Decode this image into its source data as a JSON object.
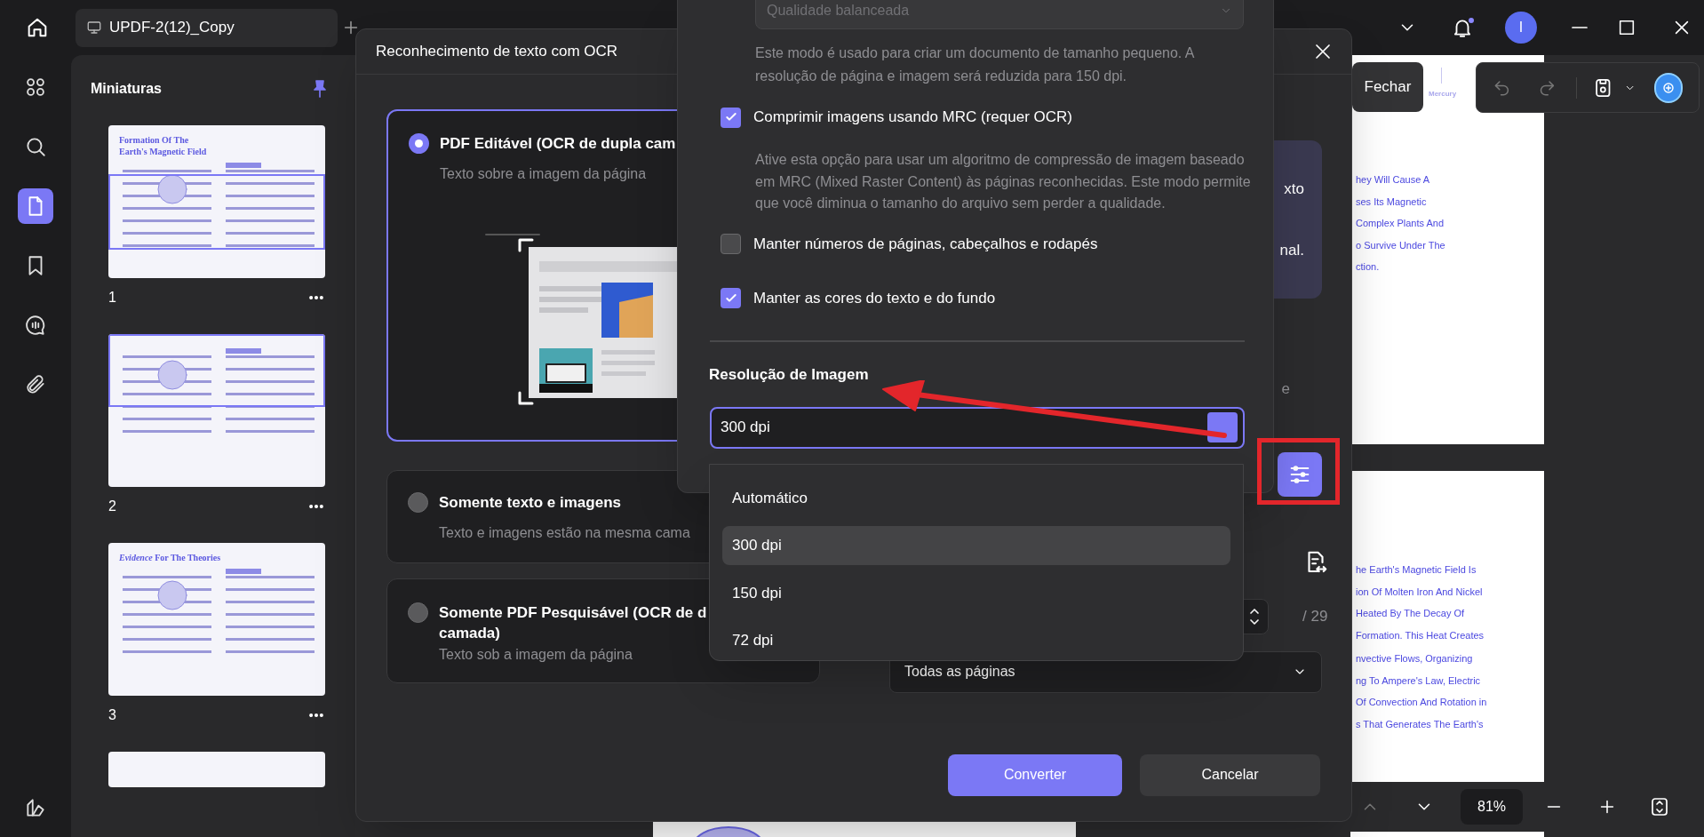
{
  "topbar": {
    "tab_title": "UPDF-2(12)_Copy",
    "avatar_letter": "I"
  },
  "rail": [
    {
      "kind": "grid",
      "selected": false
    },
    {
      "kind": "search",
      "selected": false
    },
    {
      "kind": "page",
      "selected": true
    },
    {
      "kind": "bookmark",
      "selected": false
    },
    {
      "kind": "comment",
      "selected": false
    },
    {
      "kind": "attachment",
      "selected": false
    }
  ],
  "thumbnails": {
    "title": "Miniaturas",
    "pages": [
      {
        "label": "1",
        "heading": [
          "Formation Of The",
          "Earth's Magnetic Field"
        ]
      },
      {
        "label": "2"
      },
      {
        "label": "3",
        "heading": [
          "*Evidence* **For The Theories**"
        ]
      }
    ]
  },
  "document": {
    "close_label": "Fechar",
    "header_word": "Mercury",
    "zoom": "81%",
    "page1_lines": [
      "hey Will Cause A",
      "ses Its Magnetic",
      "Complex Plants And",
      "o Survive Under The",
      "ction."
    ],
    "page2_paragraphs": [
      [
        "he Earth's Magnetic Field Is",
        "ion Of Molten Iron And Nickel",
        "Heated By The Decay Of",
        "Formation. This Heat Creates"
      ],
      [
        "nvective Flows, Organizing",
        "ng To Ampere's Law, Electric",
        "Of Convection And Rotation in",
        "s That Generates The Earth's"
      ]
    ]
  },
  "ocr_dialog": {
    "title": "Reconhecimento de texto com OCR",
    "options": [
      {
        "title_lines": [
          "PDF Editável (OCR de dupla cam"
        ],
        "subtitle": "Texto sobre a imagem da página",
        "selected": true
      },
      {
        "title_lines": [
          "Somente texto e imagens"
        ],
        "subtitle": "Texto e imagens estão na mesma cama",
        "selected": false
      },
      {
        "title_lines": [
          "Somente PDF Pesquisável (OCR de d",
          "camada)"
        ],
        "subtitle": "Texto sob a imagem da página",
        "selected": false
      }
    ],
    "side_card_lines": [
      "xto",
      "nal."
    ],
    "side_fragment": "e",
    "page_total": "/ 29",
    "page_range": "Todas as páginas",
    "buttons": [
      {
        "label": "Converter",
        "kind": "primary"
      },
      {
        "label": "Cancelar",
        "kind": "secondary"
      }
    ]
  },
  "settings_panel": {
    "quality_select": "Qualidade balanceada",
    "quality_note": "Este modo é usado para criar um documento de tamanho pequeno. A resolução de página e imagem será reduzida para 150 dpi.",
    "checks": [
      {
        "label": "Comprimir imagens usando MRC (requer OCR)",
        "checked": true,
        "note": "Ative esta opção para usar um algoritmo de compressão de imagem baseado em MRC (Mixed Raster Content) às páginas reconhecidas. Este modo permite que você diminua o tamanho do arquivo sem perder a qualidade."
      },
      {
        "label": "Manter números de páginas, cabeçalhos e rodapés",
        "checked": false
      },
      {
        "label": "Manter as cores do texto e do fundo",
        "checked": true
      }
    ],
    "resolution_label": "Resolução de Imagem",
    "resolution_value": "300 dpi",
    "resolution_options": [
      {
        "label": "Automático",
        "selected": false
      },
      {
        "label": "300 dpi",
        "selected": true
      },
      {
        "label": "150 dpi",
        "selected": false
      },
      {
        "label": "72 dpi",
        "selected": false
      }
    ]
  }
}
